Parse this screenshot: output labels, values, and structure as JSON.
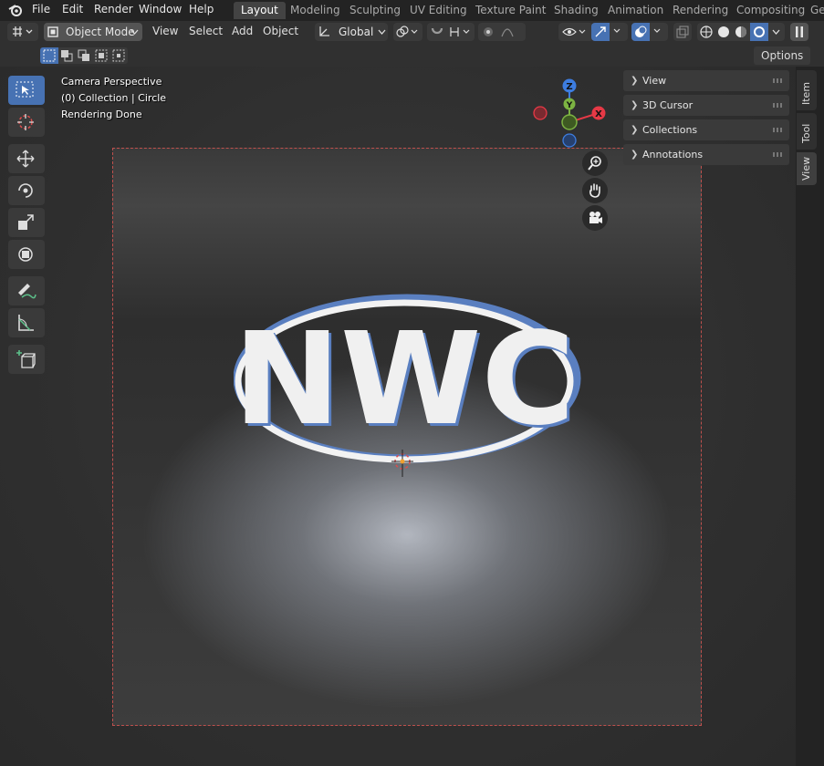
{
  "topbar": {
    "menus": [
      "File",
      "Edit",
      "Render",
      "Window",
      "Help"
    ],
    "workspaces": [
      "Layout",
      "Modeling",
      "Sculpting",
      "UV Editing",
      "Texture Paint",
      "Shading",
      "Animation",
      "Rendering",
      "Compositing",
      "Ge"
    ],
    "active_workspace": "Layout"
  },
  "header": {
    "mode": "Object Mode",
    "menus": [
      "View",
      "Select",
      "Add",
      "Object"
    ],
    "orientation": "Global"
  },
  "row2": {
    "options_label": "Options"
  },
  "viewport": {
    "info_line1": "Camera Perspective",
    "info_line2": "(0) Collection | Circle",
    "info_line3": "Rendering Done",
    "logo_text": "NWC",
    "gizmo": {
      "z": "Z",
      "y": "Y",
      "x": "X"
    }
  },
  "npanel": {
    "sections": [
      "View",
      "3D Cursor",
      "Collections",
      "Annotations"
    ],
    "tabs": [
      "Item",
      "Tool",
      "View"
    ]
  },
  "colors": {
    "accent": "#4772b3",
    "x_axis": "#e63946",
    "y_axis": "#7cb342",
    "z_axis": "#3d7de0"
  }
}
